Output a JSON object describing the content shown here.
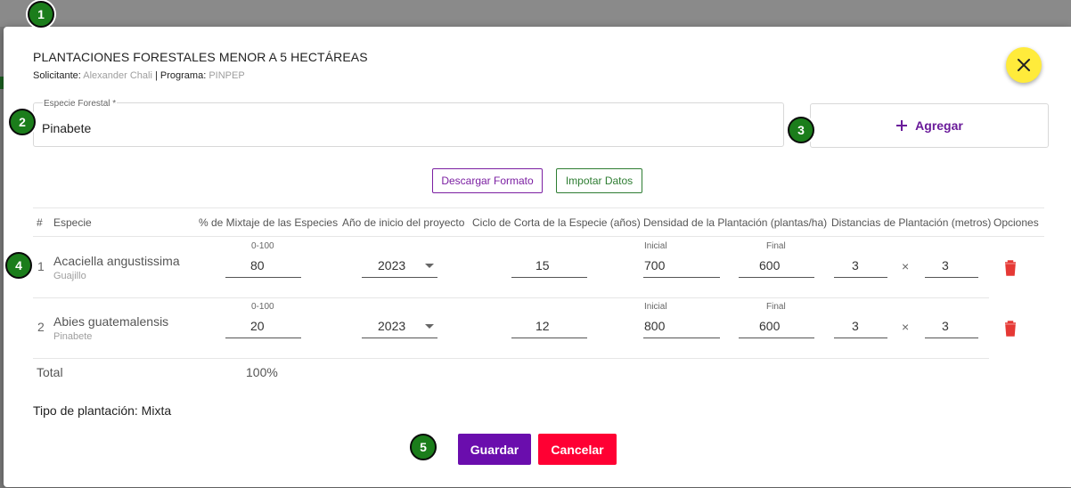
{
  "dialog": {
    "title": "PLANTACIONES FORESTALES MENOR A 5 HECTÁREAS",
    "applicant_label": "Solicitante:",
    "applicant_value": "Alexander Chali",
    "separator": "|",
    "program_label": "Programa:",
    "program_value": "PINPEP"
  },
  "species_field": {
    "label": "Especie Forestal *",
    "value": "Pinabete"
  },
  "add_button": {
    "label": "Agregar"
  },
  "actions": {
    "download_label": "Descargar Formato",
    "import_label": "Impotar Datos"
  },
  "table": {
    "headers": {
      "num": "#",
      "species": "Especie",
      "mix": "% de Mixtaje de las Especies",
      "year": "Año de inicio del proyecto",
      "cycle": "Ciclo de Corta de la Especie (años)",
      "density": "Densidad de la Plantación (plantas/ha)",
      "distance": "Distancias de Plantación (metros)",
      "options": "Opciones"
    },
    "rows": [
      {
        "num": "1",
        "name": "Acaciella angustissima",
        "common": "Guajillo",
        "mix_hint": "0-100",
        "mix": "80",
        "year": "2023",
        "cycle": "15",
        "initial_label": "Inicial",
        "initial": "700",
        "final_label": "Final",
        "final": "600",
        "dist_a": "3",
        "times": "×",
        "dist_b": "3"
      },
      {
        "num": "2",
        "name": "Abies guatemalensis",
        "common": "Pinabete",
        "mix_hint": "0-100",
        "mix": "20",
        "year": "2023",
        "cycle": "12",
        "initial_label": "Inicial",
        "initial": "800",
        "final_label": "Final",
        "final": "600",
        "dist_a": "3",
        "times": "×",
        "dist_b": "3"
      }
    ],
    "total_label": "Total",
    "total_value": "100%"
  },
  "plantation_type": "Tipo de plantación: Mixta",
  "footer": {
    "save_label": "Guardar",
    "cancel_label": "Cancelar"
  },
  "markers": [
    "1",
    "2",
    "3",
    "4",
    "5"
  ],
  "colors": {
    "accent_purple": "#6a0dad",
    "cancel_red": "#ff0033",
    "close_yellow": "#ffeb3b",
    "import_green": "#2e7d32",
    "trash_red": "#e53935",
    "marker_green": "#1b7d1b"
  }
}
